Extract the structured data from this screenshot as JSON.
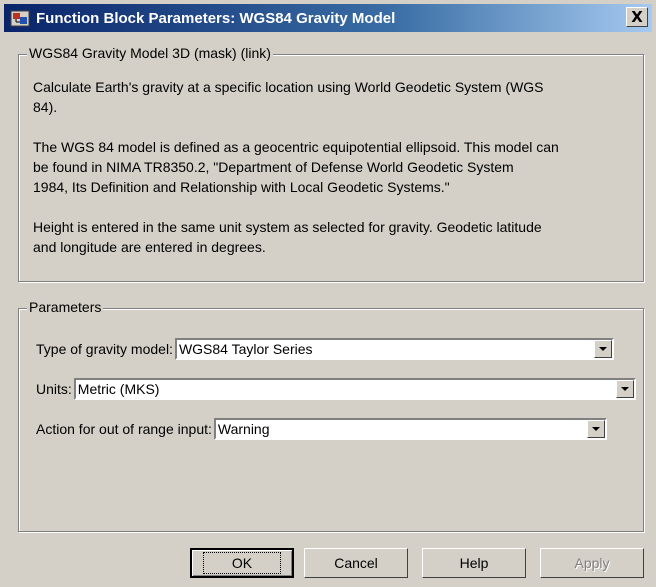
{
  "window": {
    "title": "Function Block Parameters: WGS84 Gravity Model",
    "close_label": "X"
  },
  "description": {
    "legend": "WGS84 Gravity Model 3D (mask) (link)",
    "paragraphs": [
      [
        "Calculate Earth's gravity at a specific location using World Geodetic System (WGS",
        "84)."
      ],
      [
        "The WGS 84 model is defined as a geocentric equipotential ellipsoid. This model can",
        "be found in NIMA TR8350.2,  \"Department of Defense World Geodetic System",
        "1984, Its Definition and Relationship with Local Geodetic Systems.\""
      ],
      [
        "Height is entered in the same unit system as selected for gravity. Geodetic latitude",
        "and longitude are entered in degrees."
      ]
    ]
  },
  "parameters": {
    "legend": "Parameters",
    "gravity_model": {
      "label": "Type of gravity model:",
      "value": "WGS84 Taylor Series"
    },
    "units": {
      "label": "Units:",
      "value": "Metric (MKS)"
    },
    "out_of_range": {
      "label": "Action for out of range input:",
      "value": "Warning"
    }
  },
  "buttons": {
    "ok": "OK",
    "cancel": "Cancel",
    "help": "Help",
    "apply": "Apply"
  }
}
